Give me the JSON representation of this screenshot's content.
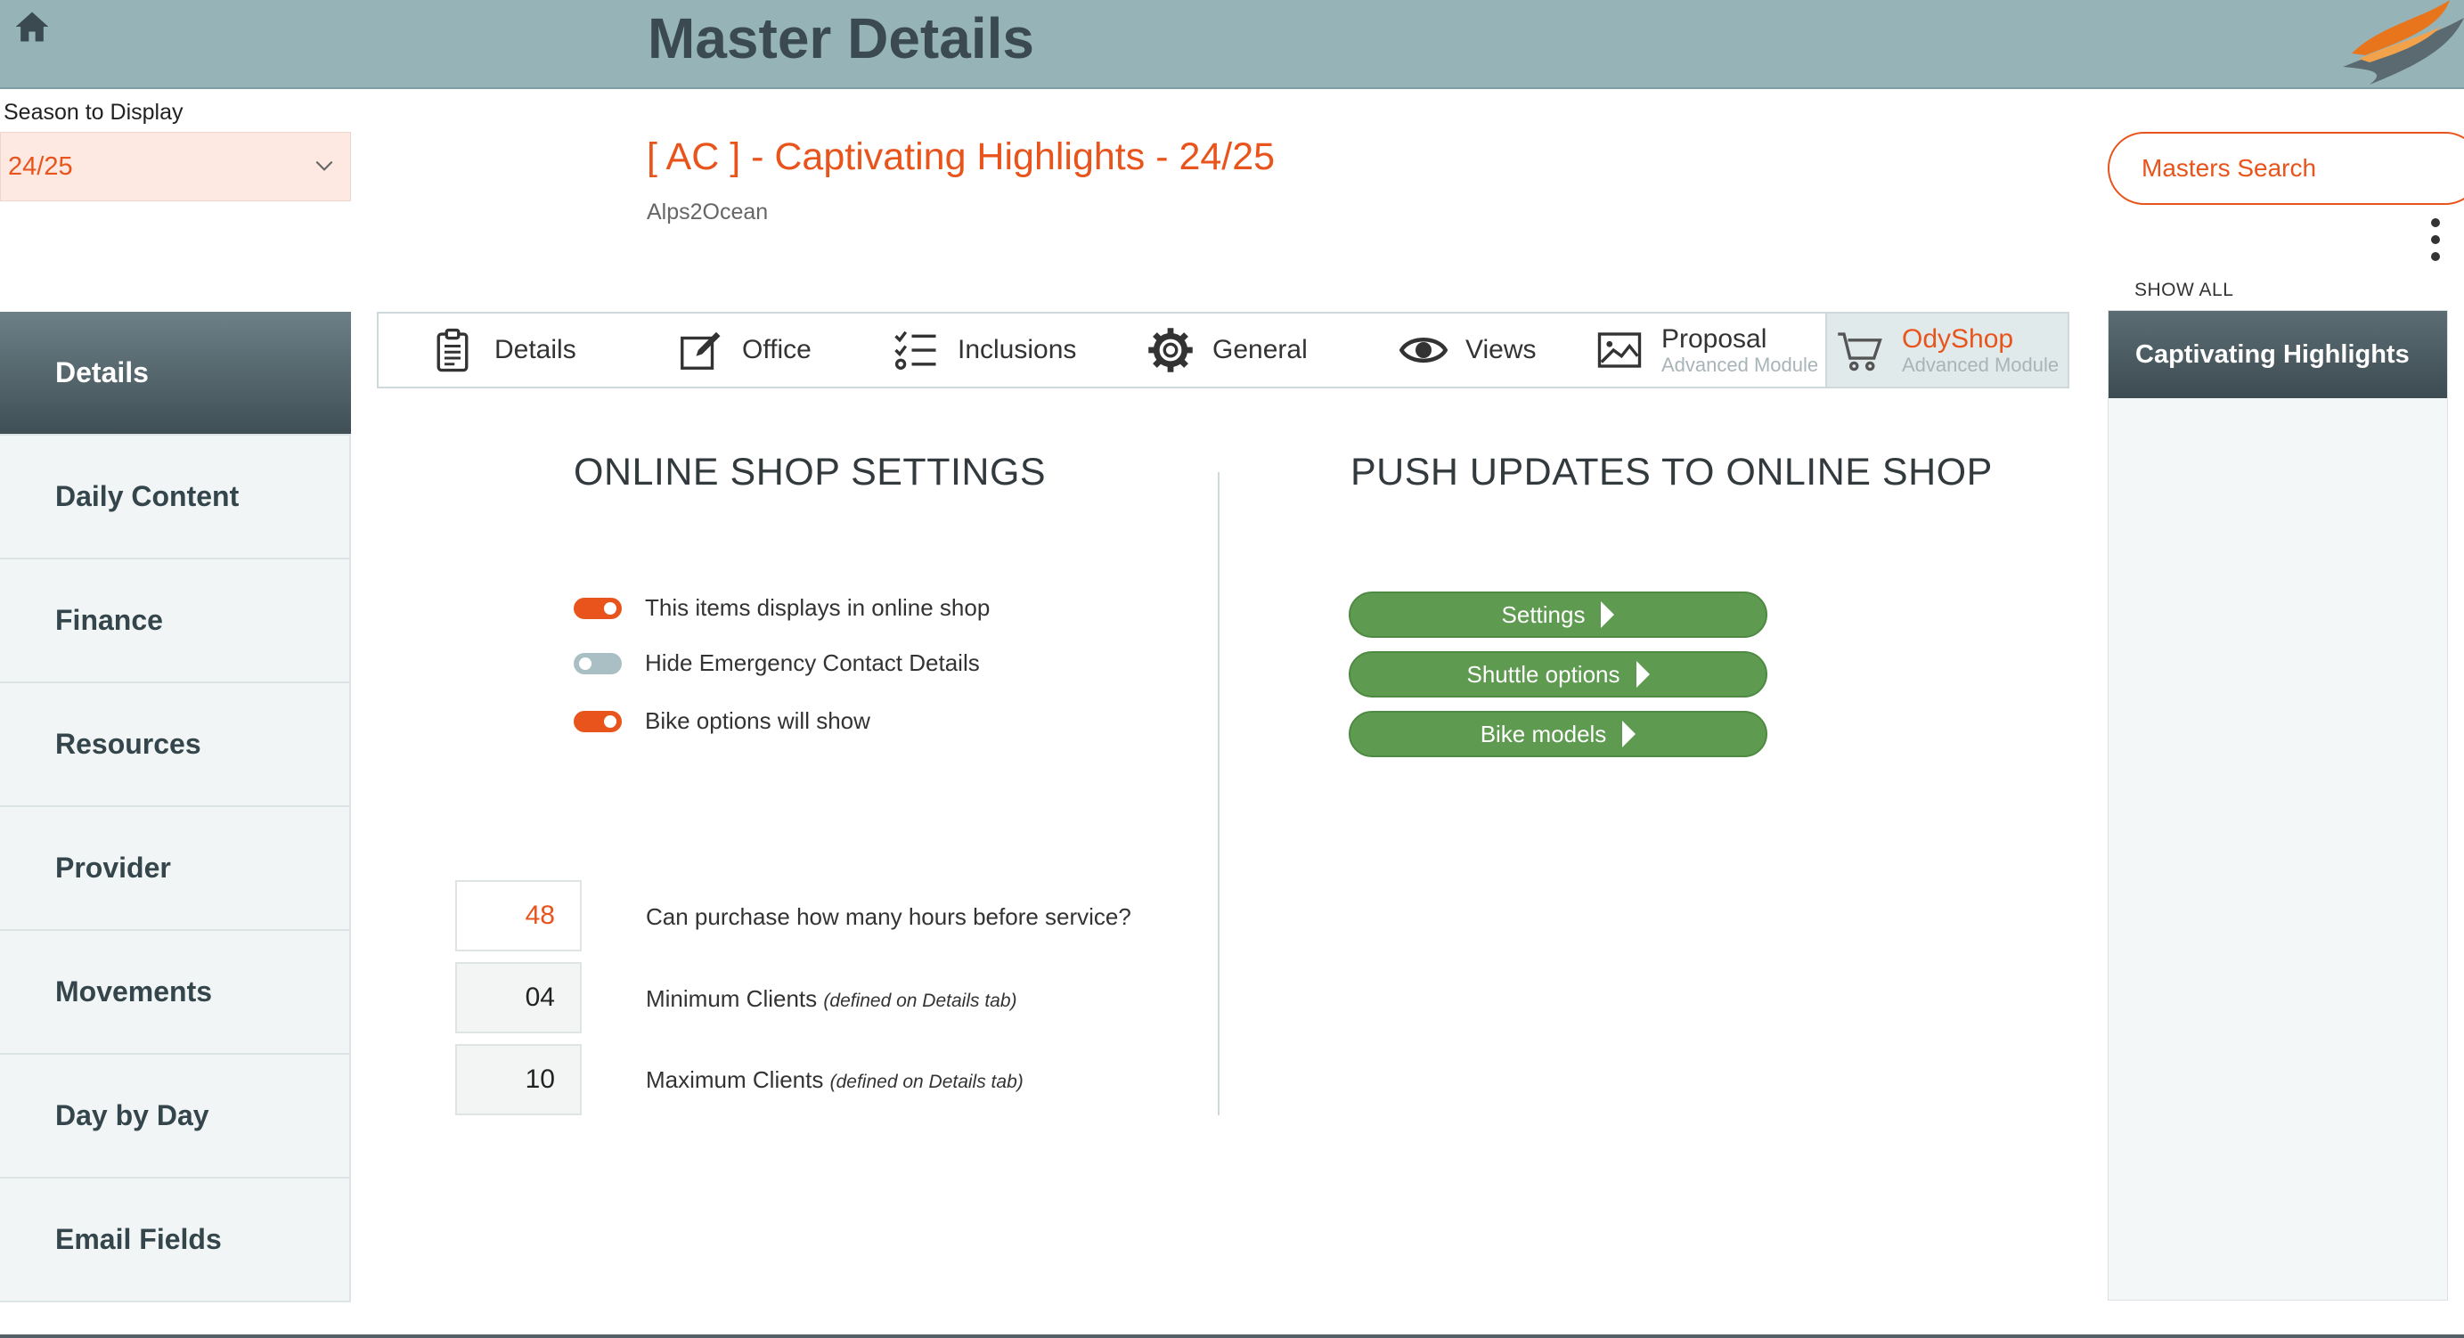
{
  "header": {
    "title": "Master Details"
  },
  "season": {
    "label": "Season to Display",
    "value": "24/25"
  },
  "record": {
    "title": "[ AC ] - Captivating Highlights - 24/25",
    "subtitle": "Alps2Ocean"
  },
  "search": {
    "label": "Masters Search"
  },
  "right_panel": {
    "show_all": "SHOW ALL",
    "items": [
      "Captivating Highlights"
    ]
  },
  "nav": {
    "items": [
      {
        "label": "Details",
        "active": true
      },
      {
        "label": "Daily Content"
      },
      {
        "label": "Finance"
      },
      {
        "label": "Resources"
      },
      {
        "label": "Provider"
      },
      {
        "label": "Movements"
      },
      {
        "label": "Day by Day"
      },
      {
        "label": "Email Fields"
      }
    ]
  },
  "tabs": [
    {
      "label": "Details",
      "icon": "clipboard-icon"
    },
    {
      "label": "Office",
      "icon": "edit-icon"
    },
    {
      "label": "Inclusions",
      "icon": "checklist-icon"
    },
    {
      "label": "General",
      "icon": "gear-icon"
    },
    {
      "label": "Views",
      "icon": "eye-icon"
    },
    {
      "label": "Proposal",
      "sub": "Advanced Module",
      "icon": "image-icon"
    },
    {
      "label": "OdyShop",
      "sub": "Advanced Module",
      "icon": "cart-icon",
      "active": true
    }
  ],
  "shop_settings": {
    "heading": "ONLINE SHOP SETTINGS",
    "toggles": [
      {
        "label": "This items displays in online shop",
        "on": true
      },
      {
        "label": "Hide Emergency Contact Details",
        "on": false
      },
      {
        "label": "Bike options will show",
        "on": true
      }
    ],
    "fields": [
      {
        "value": "48",
        "label": "Can purchase how many hours before service?",
        "note": ""
      },
      {
        "value": "04",
        "label": "Minimum Clients",
        "note": "(defined on Details tab)"
      },
      {
        "value": "10",
        "label": "Maximum Clients",
        "note": "(defined on Details tab)"
      }
    ]
  },
  "push_updates": {
    "heading": "PUSH UPDATES TO ONLINE SHOP",
    "buttons": [
      "Settings",
      "Shuttle options",
      "Bike models"
    ]
  },
  "colors": {
    "accent": "#e8541b",
    "header": "#96b4b8",
    "nav_active": "#3f4f55",
    "push": "#5e9a50"
  }
}
